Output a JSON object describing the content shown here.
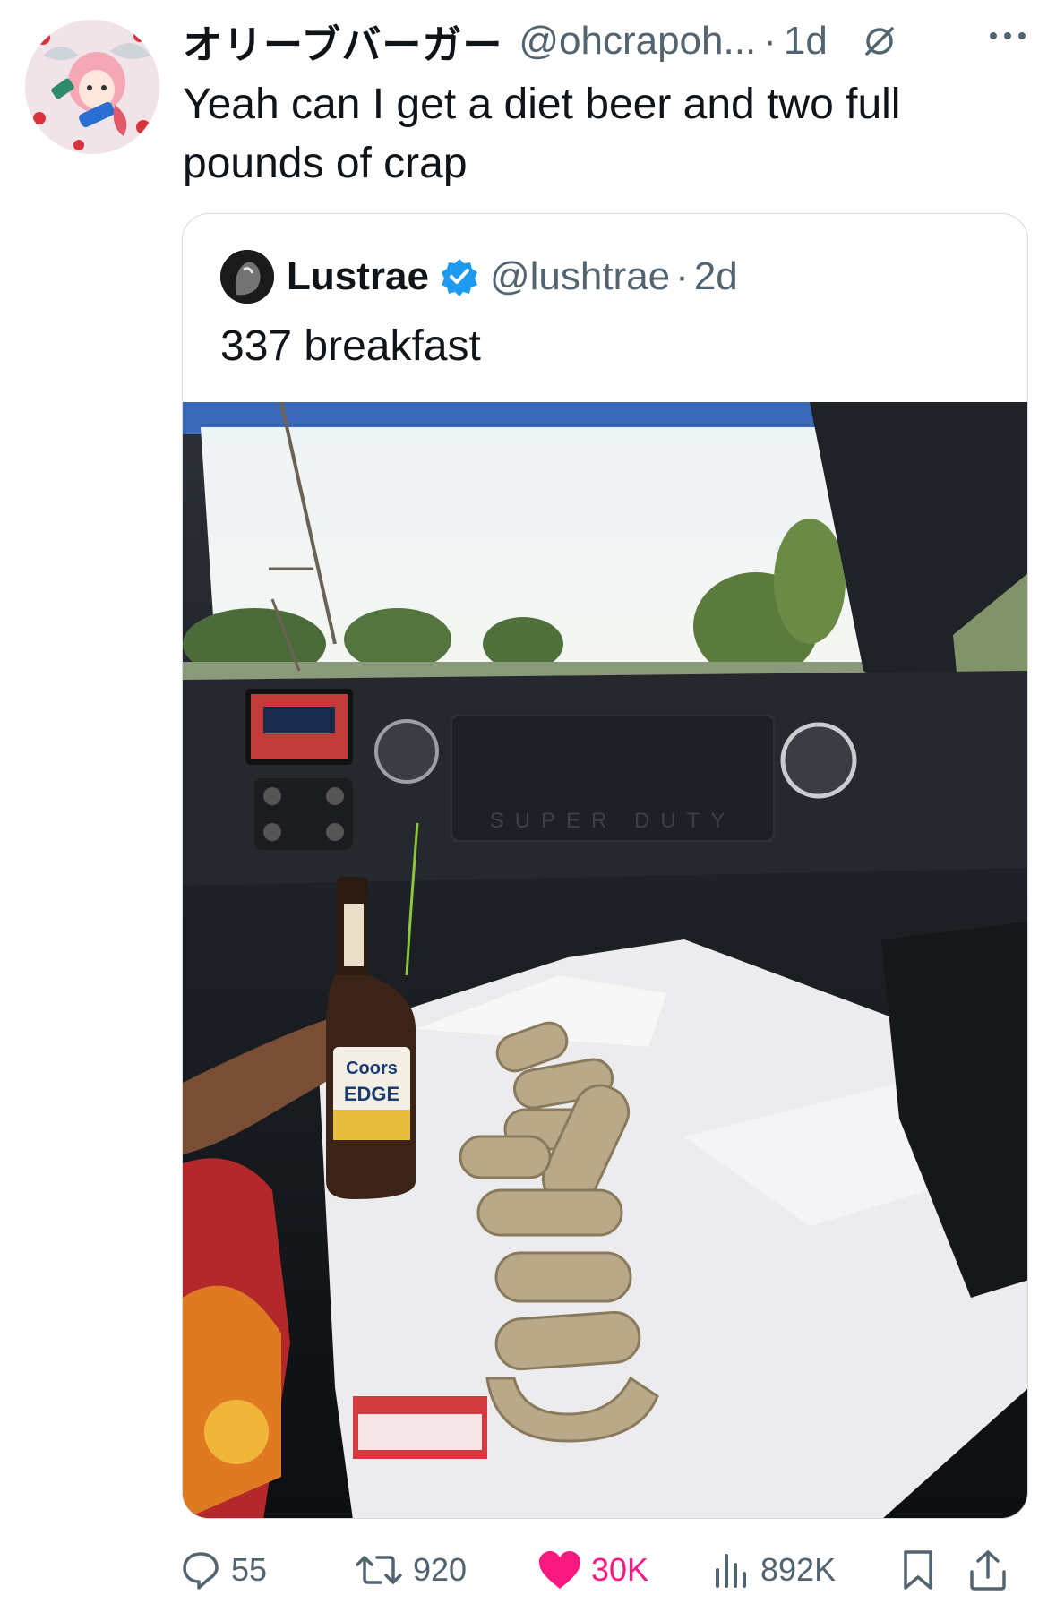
{
  "tweet": {
    "display_name": "オリーブバーガー",
    "handle": "@ohcrapoh...",
    "separator": "·",
    "time": "1d",
    "text": "Yeah can I get a diet beer and two full pounds of crap",
    "icons": {
      "avatar": "anime-character-avatar",
      "mute": "mute-icon",
      "more": "more-icon"
    }
  },
  "quote": {
    "display_name": "Lustrae",
    "handle": "@lushtrae",
    "separator": "·",
    "time": "2d",
    "text": "337 breakfast",
    "verified_color": "#1d9bf0",
    "photo_labels": {
      "bottle_brand": "Coors",
      "bottle_edition": "EDGE",
      "dash_brand": "SUPER DUTY"
    }
  },
  "actions": {
    "replies": "55",
    "reposts": "920",
    "likes": "30K",
    "views": "892K",
    "like_color": "#f91880"
  }
}
